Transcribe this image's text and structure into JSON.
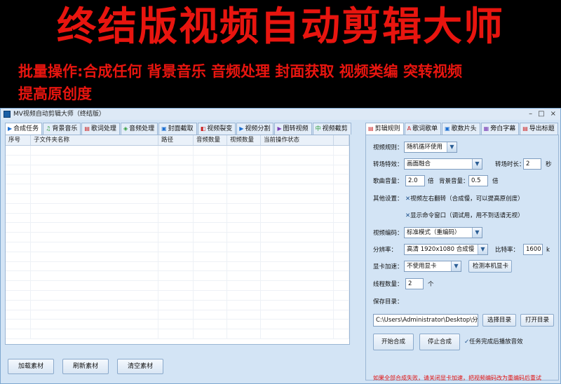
{
  "banner": {
    "title": "终结版视频自动剪辑大师",
    "line1": "批量操作:合成任何 背景音乐 音频处理 封面获取 视频类编 突转视频",
    "line2": "提高原创度"
  },
  "window": {
    "title": "MV视频自动剪辑大师（终结版）",
    "controls": [
      "–",
      "□",
      "×"
    ]
  },
  "left_tabs": [
    {
      "label": "合成任务",
      "icon": "▶"
    },
    {
      "label": "背景音乐",
      "icon": "♫"
    },
    {
      "label": "歌词处理",
      "icon": "▤"
    },
    {
      "label": "音频处理",
      "icon": "◈"
    },
    {
      "label": "封面截取",
      "icon": "▣"
    },
    {
      "label": "视频裂变",
      "icon": "◧"
    },
    {
      "label": "视频分割",
      "icon": "▶"
    },
    {
      "label": "图转视频",
      "icon": "▶"
    },
    {
      "label": "视频截剪",
      "icon": "中"
    }
  ],
  "table": {
    "columns": [
      "序号",
      "子文件夹名称",
      "路径",
      "音频数量",
      "视频数量",
      "当前操作状态",
      ""
    ]
  },
  "left_buttons": {
    "load": "加载素材",
    "refresh": "刷新素材",
    "clear": "清空素材"
  },
  "right_tabs": [
    {
      "label": "剪辑规则",
      "icon": "▤"
    },
    {
      "label": "歌词歌单",
      "icon": "A"
    },
    {
      "label": "歌数片头",
      "icon": "▣"
    },
    {
      "label": "旁白字幕",
      "icon": "▦"
    },
    {
      "label": "导出标题",
      "icon": "▤"
    }
  ],
  "settings": {
    "video_rule_label": "视频规则：",
    "video_rule_value": "随机循环使用",
    "transition_label": "转场特效：",
    "transition_value": "画面融合",
    "transition_time_label": "转场时长：",
    "transition_time_value": "2",
    "transition_time_unit": "秒",
    "song_volume_label": "歌曲音量：",
    "song_volume_value": "2.0",
    "song_volume_unit": "倍",
    "bg_volume_label": "背景音量：",
    "bg_volume_value": "0.5",
    "bg_volume_unit": "倍",
    "other_label": "其他设置：",
    "flip_check": "视频左右翻转（合成慢，可以提高原创度）",
    "cmd_check": "显示命令窗口（调试用，用不到话请无视）",
    "encode_label": "视频编码：",
    "encode_value": "标准模式（重编码）",
    "resolution_label": "分辨率：",
    "resolution_value": "高清 1920x1080 合成慢",
    "bitrate_label": "比特率：",
    "bitrate_value": "1600",
    "bitrate_unit": "k",
    "gpu_label": "显卡加速：",
    "gpu_value": "不使用显卡",
    "gpu_detect_btn": "检测本机显卡",
    "threads_label": "线程数量：",
    "threads_value": "2",
    "threads_unit": "个",
    "save_dir_label": "保存目录：",
    "save_dir_value": "C:\\Users\\Administrator\\Desktop\\分",
    "choose_dir_btn": "选择目录",
    "open_dir_btn": "打开目录",
    "start_btn": "开始合成",
    "stop_btn": "停止合成",
    "done_sound_check": "任务完成后播放音效",
    "warning": "如果全部合成失败，请关闭显卡加速，把视频编码改为重编码后重试"
  },
  "colors": {
    "banner_text": "#e8150f",
    "window_bg": "#d3e4f5",
    "warning_text": "#e01010"
  }
}
